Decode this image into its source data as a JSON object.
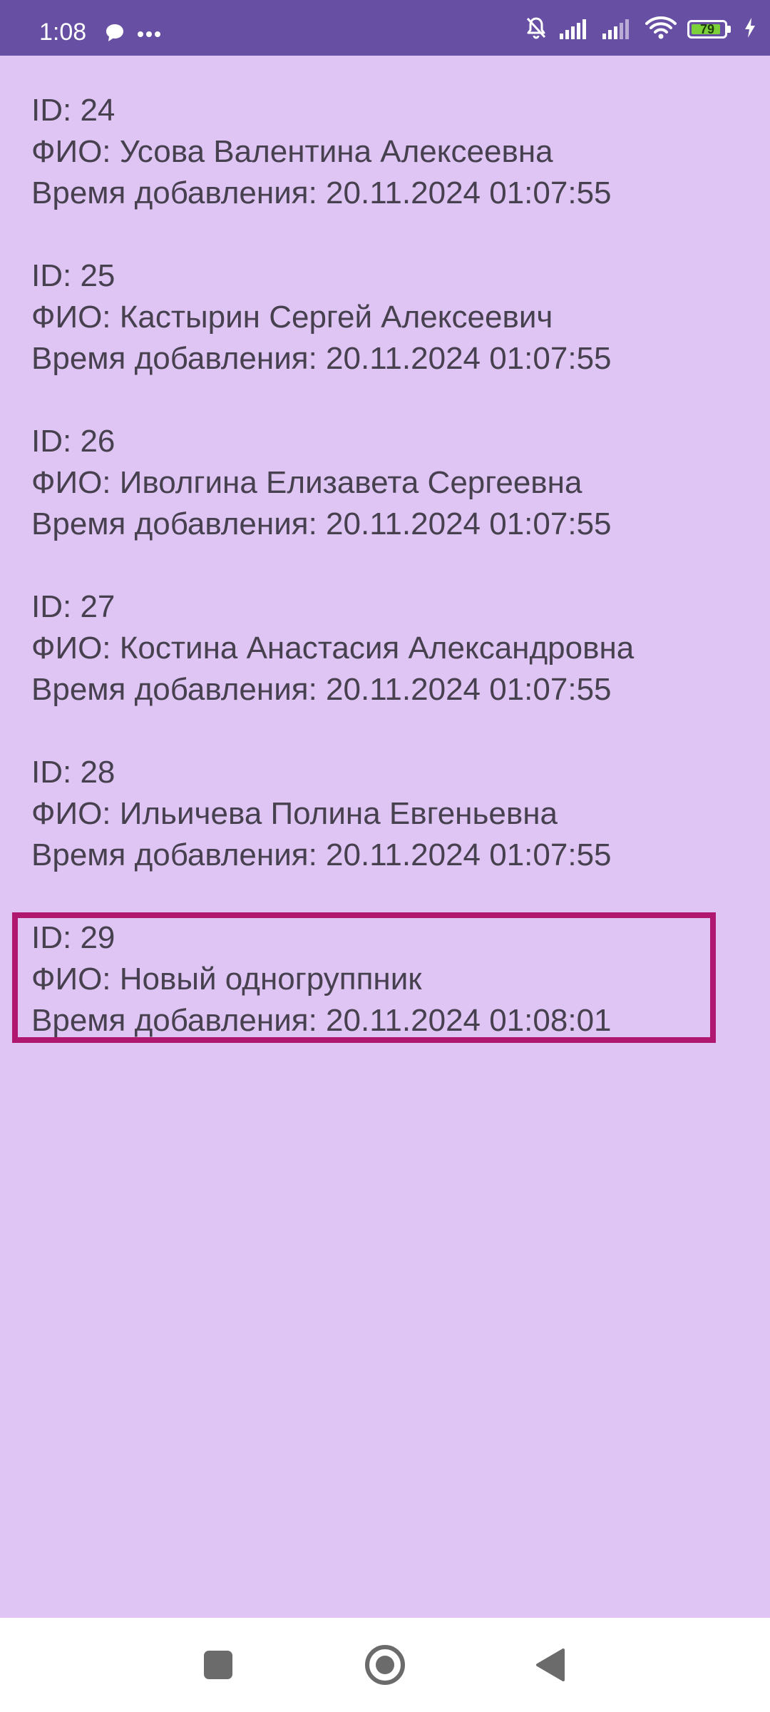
{
  "status_bar": {
    "time": "1:08",
    "battery_level": "79",
    "background_color": "#6750a4"
  },
  "records": [
    {
      "id_line": "ID: 24",
      "name_line": "ФИО: Усова Валентина Алексеевна",
      "time_line": "Время добавления: 20.11.2024 01:07:55"
    },
    {
      "id_line": "ID: 25",
      "name_line": "ФИО: Кастырин Сергей Алексеевич",
      "time_line": "Время добавления: 20.11.2024 01:07:55"
    },
    {
      "id_line": "ID: 26",
      "name_line": "ФИО: Иволгина Елизавета Сергеевна",
      "time_line": "Время добавления: 20.11.2024 01:07:55"
    },
    {
      "id_line": "ID: 27",
      "name_line": "ФИО: Костина Анастасия Александровна",
      "time_line": "Время добавления: 20.11.2024 01:07:55"
    },
    {
      "id_line": "ID: 28",
      "name_line": "ФИО: Ильичева Полина Евгеньевна",
      "time_line": "Время добавления: 20.11.2024 01:07:55"
    },
    {
      "id_line": "ID: 29",
      "name_line": "ФИО: Новый одногруппник",
      "time_line": "Время добавления: 20.11.2024 01:08:01"
    }
  ],
  "colors": {
    "list_background": "#dec5f3",
    "text": "#46404f",
    "highlight_border": "#b0186f"
  },
  "nav_bar": {
    "icons": [
      "recents-square-icon",
      "home-circle-icon",
      "back-triangle-icon"
    ]
  }
}
